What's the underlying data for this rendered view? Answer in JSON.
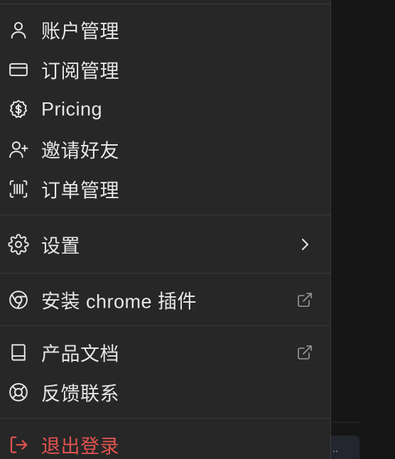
{
  "menu": {
    "items": [
      {
        "label": "账户管理",
        "icon": "user-icon"
      },
      {
        "label": "订阅管理",
        "icon": "credit-card-icon"
      },
      {
        "label": "Pricing",
        "icon": "dollar-badge-icon"
      },
      {
        "label": "邀请好友",
        "icon": "user-plus-icon"
      },
      {
        "label": "订单管理",
        "icon": "barcode-scan-icon"
      },
      {
        "label": "设置",
        "icon": "gear-icon",
        "trail": "chevron-right-icon"
      },
      {
        "label": "安装 chrome 插件",
        "icon": "chrome-icon",
        "trail": "external-link-icon"
      },
      {
        "label": "产品文档",
        "icon": "book-icon",
        "trail": "external-link-icon"
      },
      {
        "label": "反馈联系",
        "icon": "lifebuoy-icon"
      },
      {
        "label": "退出登录",
        "icon": "logout-icon"
      }
    ]
  },
  "background": {
    "button_text": ".."
  },
  "colors": {
    "menu_bg": "#272727",
    "text": "#e6e6e6",
    "danger": "#e0534f",
    "divider": "#3b3b3b",
    "page_bg": "#161616"
  }
}
